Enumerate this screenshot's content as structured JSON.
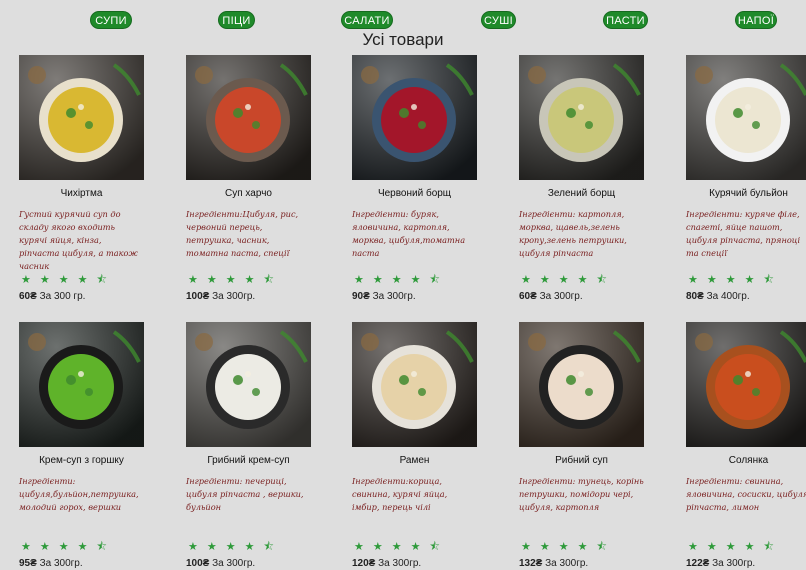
{
  "nav": [
    {
      "label": "СУПИ"
    },
    {
      "label": "ПІЦИ"
    },
    {
      "label": "САЛАТИ"
    },
    {
      "label": "СУШІ"
    },
    {
      "label": "ПАСТИ"
    },
    {
      "label": "НАПОЇ"
    }
  ],
  "page_title": "Усі товари",
  "rating_icon": "star-icon",
  "accent_color": "#1f8a2a",
  "products": [
    {
      "name": "Чихіртма",
      "description": "Густий курячий суп до складу якого входить курячі яйця, кінза, ріпчаста цибуля, а також часник",
      "stars": "★★★★⯪",
      "rating": 4.5,
      "price": "60₴",
      "weight": "За 300 гр.",
      "dish": "yellow"
    },
    {
      "name": "Суп харчо",
      "description": "Інгредієнти:Цибуля, рис, червоний перець, петрушка, часник, томатна паста, спеції",
      "stars": "★★★★⯪",
      "rating": 4.5,
      "price": "100₴",
      "weight": "За 300гр.",
      "dish": "red"
    },
    {
      "name": "Червоний борщ",
      "description": "Інгредієнти: буряк, яловичина, картопля, морква, цибуля,томатна паста",
      "stars": "★★★★⯪",
      "rating": 4.5,
      "price": "90₴",
      "weight": "За 300гр.",
      "dish": "borsch"
    },
    {
      "name": "Зелений борщ",
      "description": "Інгредієнти: картопля, морква, щавель,зелень кропу,зелень петрушки, цибуля ріпчаста",
      "stars": "★★★★⯪",
      "rating": 4.5,
      "price": "60₴",
      "weight": "За 300гр.",
      "dish": "green"
    },
    {
      "name": "Курячий бульйон",
      "description": "Інгредієнти: куряче філе, спагеті, яйце пашот, цибуля ріпчаста, пряноці та спеції",
      "stars": "★★★★⯪",
      "rating": 4.5,
      "price": "80₴",
      "weight": "За 400гр.",
      "dish": "broth"
    },
    {
      "name": "Крем-суп з горшку",
      "description": "Інгредієнти: цибуля,бульйон,петрушка, молодий горох, вершки",
      "stars": "★★★★⯪",
      "rating": 4.5,
      "price": "95₴",
      "weight": "За 300гр.",
      "dish": "pea"
    },
    {
      "name": "Грибний крем-суп",
      "description": "Інгредієнти: печериці, цибуля ріпчаста , вершки, бульйон",
      "stars": "★★★★⯪",
      "rating": 4.5,
      "price": "100₴",
      "weight": "За 300гр.",
      "dish": "cream"
    },
    {
      "name": "Рамен",
      "description": "Інгредієнти:корица, свинина, курячі яйца, імбир, перець чілі",
      "stars": "★★★★⯪",
      "rating": 4.5,
      "price": "120₴",
      "weight": "За 300гр.",
      "dish": "ramen"
    },
    {
      "name": "Рибний суп",
      "description": "Інгредієнти: тунець, корінь петрушки, помідори чері, цибуля, картопля",
      "stars": "★★★★⯪",
      "rating": 4.5,
      "price": "132₴",
      "weight": "За 300гр.",
      "dish": "fish"
    },
    {
      "name": "Солянка",
      "description": "Інгредієнти: свинина, яловичина, сосиски, цибуля ріпчаста, лимон",
      "stars": "★★★★⯪",
      "rating": 4.5,
      "price": "122₴",
      "weight": "За 300гр.",
      "dish": "solyanka"
    }
  ]
}
